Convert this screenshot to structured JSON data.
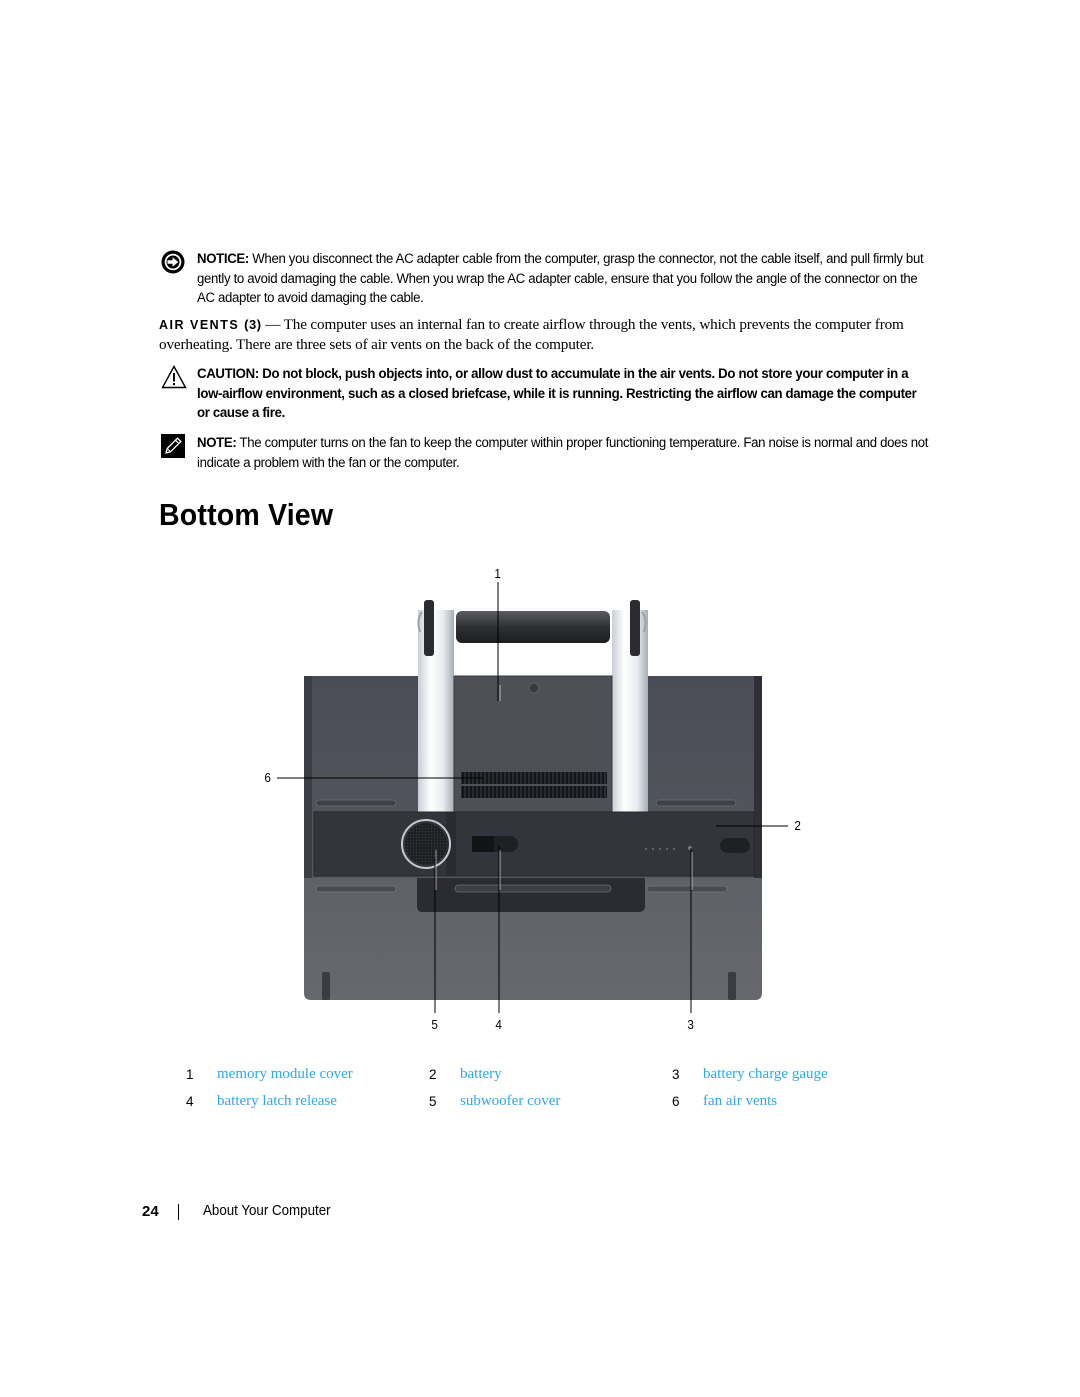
{
  "admonitions": {
    "notice": {
      "icon": "notice-arrow-icon",
      "label": "NOTICE:",
      "text": " When you disconnect the AC adapter cable from the computer, grasp the connector, not the cable itself, and pull firmly but gently to avoid damaging the cable. When you wrap the AC adapter cable, ensure that you follow the angle of the connector on the AC adapter to avoid damaging the cable."
    },
    "caution": {
      "icon": "caution-triangle-icon",
      "label": "CAUTION:",
      "text": " Do not block, push objects into, or allow dust to accumulate in the air vents. Do not store your computer in a low-airflow environment, such as a closed briefcase, while it is running. Restricting the airflow can damage the computer or cause a fire."
    },
    "note": {
      "icon": "note-pencil-icon",
      "label": "NOTE:",
      "text": " The computer turns on the fan to keep the computer within proper functioning temperature. Fan noise is normal and does not indicate a problem with the fan or the computer."
    }
  },
  "air_vents": {
    "term": "AIR VENTS",
    "number": "(3)",
    "dash": " — ",
    "text": "The computer uses an internal fan to create airflow through the vents, which prevents the computer from overheating. There are three sets of air vents on the back of the computer."
  },
  "section_heading": "Bottom View",
  "figure": {
    "description": "Bottom view photo of laptop computer with handle",
    "callouts": [
      "1",
      "2",
      "3",
      "4",
      "5",
      "6"
    ]
  },
  "legend": [
    {
      "num": "1",
      "label": "memory module cover"
    },
    {
      "num": "2",
      "label": "battery"
    },
    {
      "num": "3",
      "label": "battery charge gauge"
    },
    {
      "num": "4",
      "label": "battery latch release"
    },
    {
      "num": "5",
      "label": "subwoofer cover"
    },
    {
      "num": "6",
      "label": "fan air vents"
    }
  ],
  "colors": {
    "link": "#2fa8e6",
    "text": "#000000"
  },
  "footer": {
    "page_number": "24",
    "section": "About Your Computer"
  }
}
